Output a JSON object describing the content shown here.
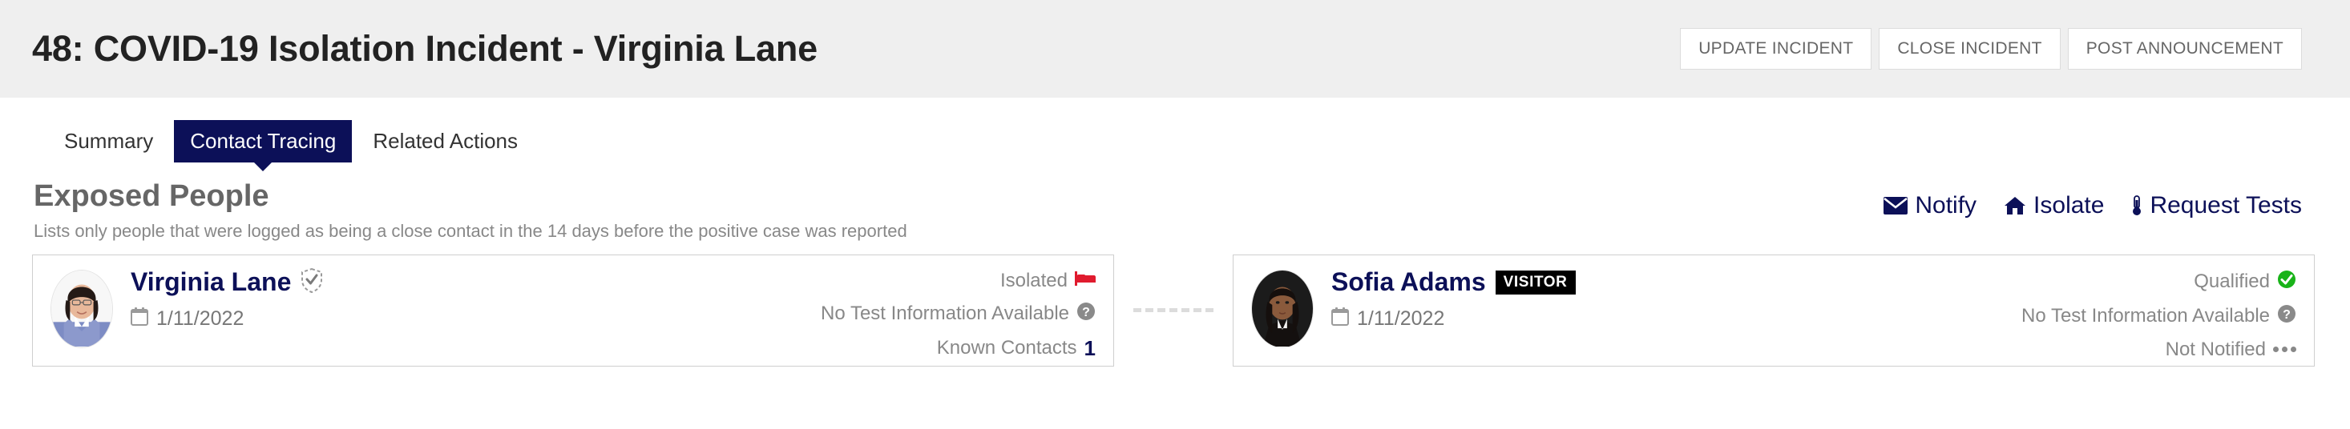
{
  "header": {
    "title": "48: COVID-19 Isolation Incident - Virginia Lane",
    "buttons": [
      {
        "label": "UPDATE INCIDENT",
        "name": "update-incident-button"
      },
      {
        "label": "CLOSE INCIDENT",
        "name": "close-incident-button"
      },
      {
        "label": "POST ANNOUNCEMENT",
        "name": "post-announcement-button"
      }
    ]
  },
  "tabs": [
    {
      "label": "Summary",
      "active": false
    },
    {
      "label": "Contact Tracing",
      "active": true
    },
    {
      "label": "Related Actions",
      "active": false
    }
  ],
  "section": {
    "title": "Exposed People",
    "subtitle": "Lists only people that were logged as being a close contact in the 14 days before the positive case was reported",
    "actions": [
      {
        "label": "Notify",
        "icon": "envelope-icon"
      },
      {
        "label": "Isolate",
        "icon": "home-icon"
      },
      {
        "label": "Request Tests",
        "icon": "thermometer-icon"
      }
    ]
  },
  "people": [
    {
      "name": "Virginia Lane",
      "badge": null,
      "verified_icon": "shield-check-dashed-icon",
      "date": "1/11/2022",
      "statuses": [
        {
          "label": "Isolated",
          "icon": "bed-icon",
          "icon_color": "#e01b2e"
        },
        {
          "label": "No Test Information Available",
          "icon": "question-circle-icon",
          "icon_color": "#8a8a8a"
        },
        {
          "label": "Known Contacts",
          "value": "1",
          "icon": "none"
        }
      ]
    },
    {
      "name": "Sofia Adams",
      "badge": "VISITOR",
      "verified_icon": null,
      "date": "1/11/2022",
      "statuses": [
        {
          "label": "Qualified",
          "icon": "check-circle-icon",
          "icon_color": "#19b319"
        },
        {
          "label": "No Test Information Available",
          "icon": "question-circle-icon",
          "icon_color": "#8a8a8a"
        },
        {
          "label": "Not Notified",
          "icon": "ellipsis-icon",
          "icon_color": "#888888"
        }
      ]
    }
  ],
  "colors": {
    "navy": "#0c1058",
    "header_band": "#efefef",
    "muted_text": "#888888",
    "red": "#e01b2e",
    "green": "#19b319"
  }
}
